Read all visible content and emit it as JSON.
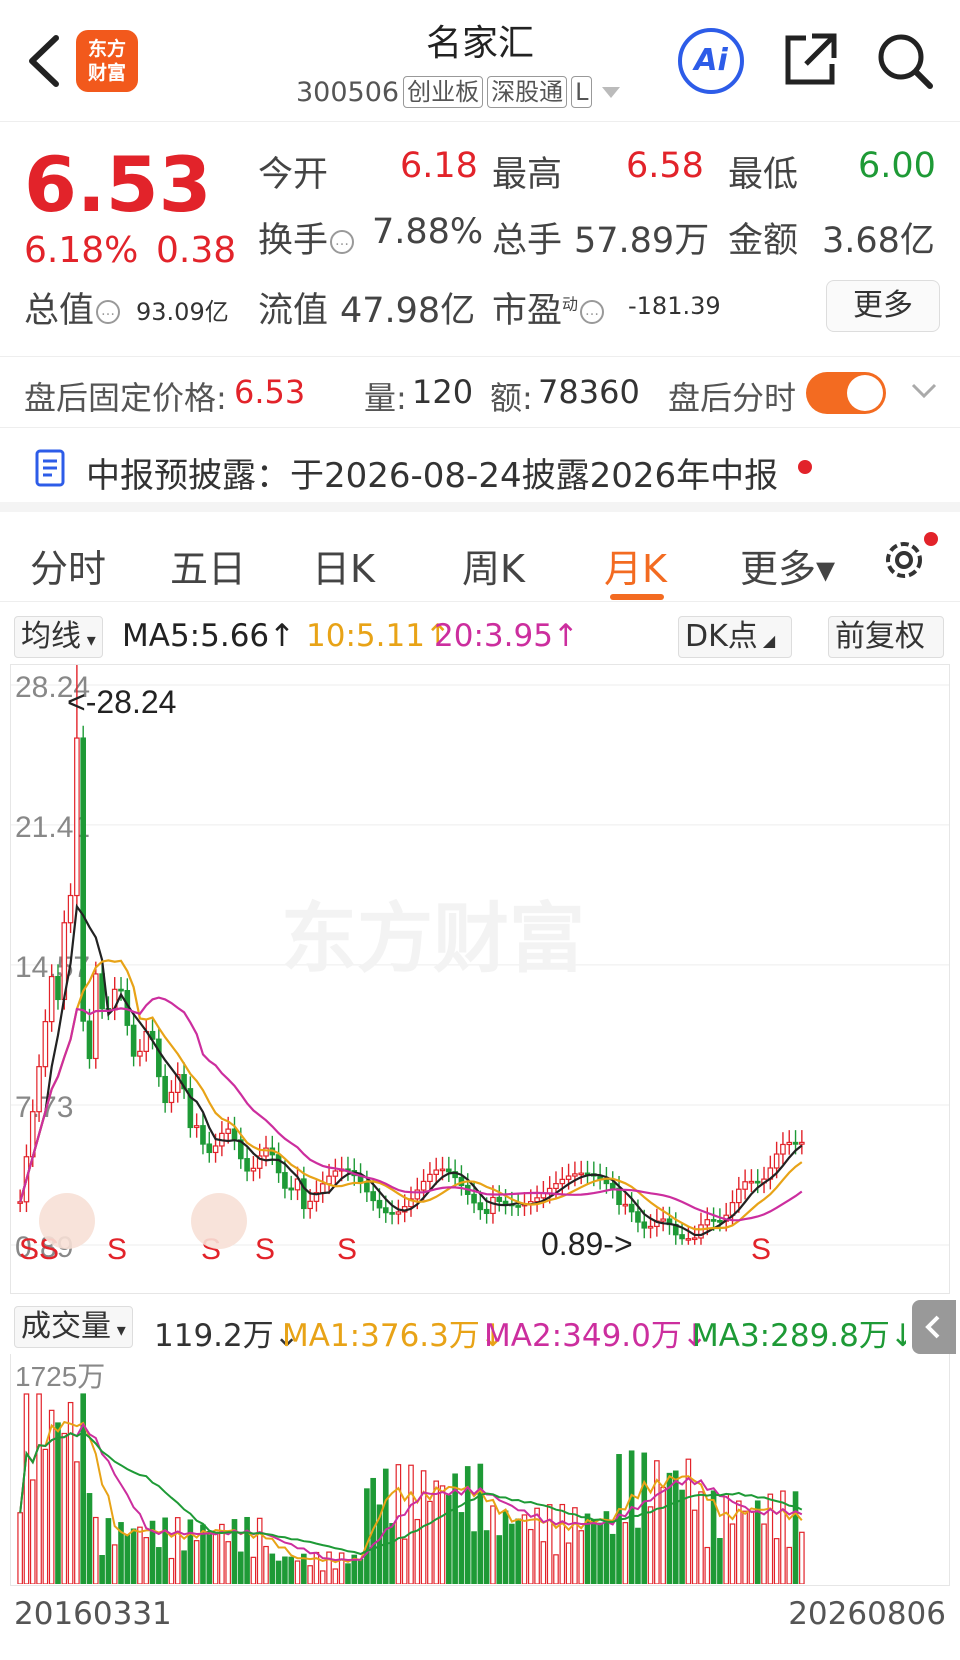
{
  "header": {
    "logo_line1": "东方",
    "logo_line2": "财富",
    "title": "名家汇",
    "code": "300506",
    "tags": [
      "创业板",
      "深股通",
      "L"
    ],
    "ai_label": "Ai"
  },
  "quote": {
    "price": "6.53",
    "pct": "6.18%",
    "change": "0.38",
    "open_label": "今开",
    "open": "6.18",
    "high_label": "最高",
    "high": "6.58",
    "low_label": "最低",
    "low": "6.00",
    "turnover_label": "换手",
    "turnover": "7.88%",
    "volume_label": "总手",
    "volume": "57.89万",
    "amount_label": "金额",
    "amount": "3.68亿",
    "mcap_label": "总值",
    "mcap": "93.09亿",
    "float_label": "流值",
    "float": "47.98亿",
    "pe_label": "市盈",
    "pe_sup": "动",
    "pe": "-181.39",
    "more_label": "更多"
  },
  "after_hours": {
    "fixed_price_label": "盘后固定价格:",
    "fixed_price": "6.53",
    "vol_label": "量:",
    "vol": "120",
    "amt_label": "额:",
    "amt": "78360",
    "timeshare_label": "盘后分时"
  },
  "notice": {
    "text": "中报预披露：于2026-08-24披露2026年中报"
  },
  "tabs": [
    "分时",
    "五日",
    "日K",
    "周K",
    "月K",
    "更多▾"
  ],
  "active_tab": "月K",
  "ma": {
    "selector": "均线",
    "ma5": "MA5:5.66↑",
    "ma10": "10:5.11↑",
    "ma20": "20:3.95↑",
    "dk_label": "DK点",
    "adjust_label": "前复权",
    "colors": {
      "ma5": "#222222",
      "ma10": "#e8a317",
      "ma20": "#cc2e9e"
    }
  },
  "chart_data": {
    "type": "candlestick",
    "y_ticks": [
      "28.24",
      "21.41",
      "14.57",
      "7.73",
      "0.89"
    ],
    "max_label": "<-28.24",
    "min_label": "0.89->",
    "signal_labels": [
      "S",
      "S",
      "S",
      "S",
      "S",
      "S",
      "S"
    ],
    "x_start": "20160331",
    "x_end": "20260806"
  },
  "volume": {
    "selector": "成交量",
    "current": "119.2万↓",
    "ma1": "MA1:376.3万↓",
    "ma2": "MA2:349.0万↓",
    "ma3": "MA3:289.8万↓",
    "max_label": "1725万",
    "colors": {
      "ma1": "#e8a317",
      "ma2": "#cc2e9e",
      "ma3": "#1e9a36"
    }
  },
  "watermark": "东方财富"
}
